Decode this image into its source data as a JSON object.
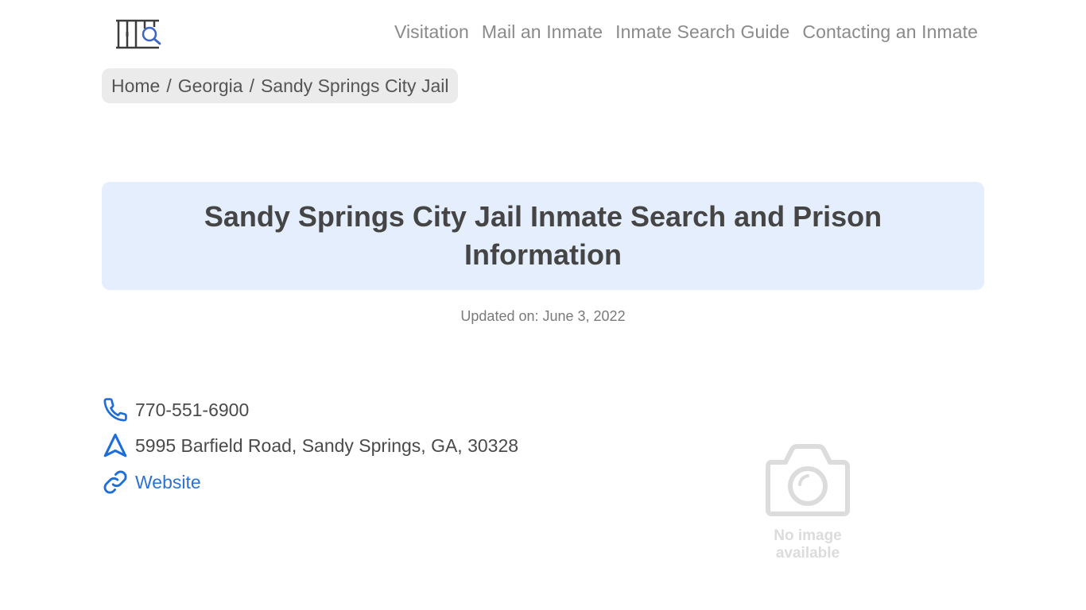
{
  "header": {
    "logo_icon": "jail-bars-search-icon",
    "nav": [
      {
        "label": "Visitation"
      },
      {
        "label": "Mail an Inmate"
      },
      {
        "label": "Inmate Search Guide"
      },
      {
        "label": "Contacting an Inmate"
      }
    ]
  },
  "breadcrumb": {
    "items": [
      {
        "label": "Home"
      },
      {
        "label": "Georgia"
      },
      {
        "label": "Sandy Springs City Jail"
      }
    ],
    "separator": "/"
  },
  "main": {
    "title": "Sandy Springs City Jail Inmate Search and Prison Information",
    "updated": "Updated on: June 3, 2022"
  },
  "contact": {
    "phone": {
      "icon": "phone-icon",
      "value": "770-551-6900"
    },
    "address": {
      "icon": "navigation-arrow-icon",
      "value": "5995 Barfield Road, Sandy Springs, GA, 30328"
    },
    "website": {
      "icon": "link-icon",
      "label": "Website"
    }
  },
  "placeholder_image": {
    "icon": "camera-icon",
    "line1": "No image",
    "line2": "available"
  },
  "colors": {
    "accent": "#2a72d4",
    "title_bg": "#e4eefc",
    "breadcrumb_bg": "#ebebeb",
    "text": "#454545"
  }
}
